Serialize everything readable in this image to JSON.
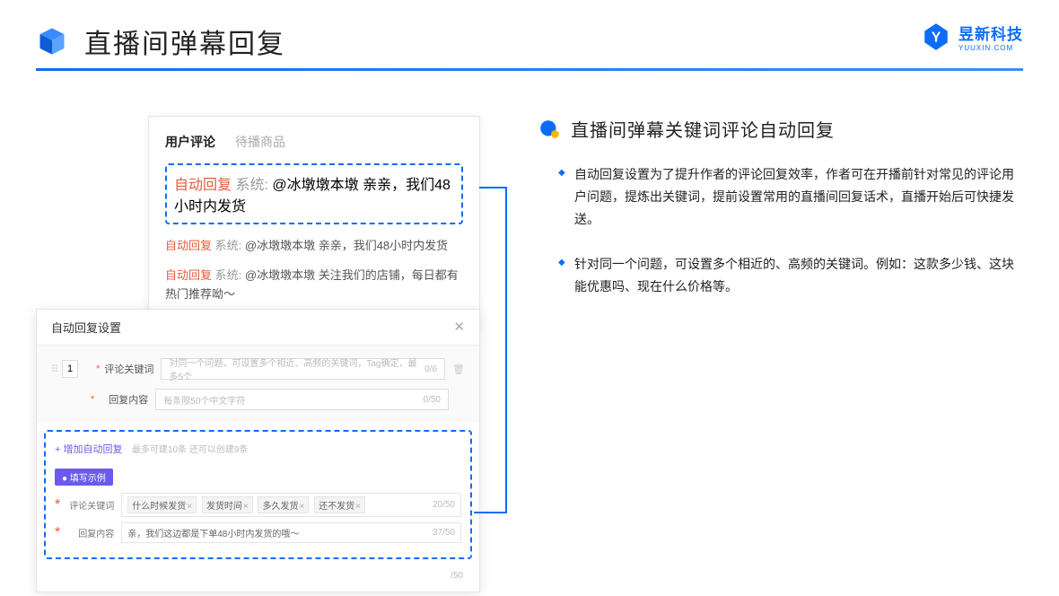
{
  "header": {
    "title": "直播间弹幕回复"
  },
  "logo": {
    "name": "昱新科技",
    "sub": "YUUXIN.COM"
  },
  "commentPanel": {
    "tabs": {
      "active": "用户评论",
      "inactive": "待播商品"
    },
    "highlighted": {
      "tag": "自动回复",
      "sys": "系统:",
      "text": "@冰墩墩本墩 亲亲，我们48小时内发货"
    },
    "rows": [
      {
        "tag": "自动回复",
        "sys": "系统:",
        "text": "@冰墩墩本墩 亲亲，我们48小时内发货"
      },
      {
        "tag": "自动回复",
        "sys": "系统:",
        "text": "@冰墩墩本墩 关注我们的店铺，每日都有热门推荐呦～"
      }
    ]
  },
  "modal": {
    "title": "自动回复设置",
    "num": "1",
    "fields": {
      "kw_label": "评论关键词",
      "kw_placeholder": "对同一个问题，可设置多个相近、高频的关键词，Tag确定，最多5个",
      "kw_count": "0/6",
      "ct_label": "回复内容",
      "ct_placeholder": "每条限50个中文字符",
      "ct_count": "0/50"
    },
    "add_link": "+ 增加自动回复",
    "add_help": "最多可建10条 还可以创建9条",
    "example_btn": "● 填写示例",
    "example": {
      "kw_label": "评论关键词",
      "tags": [
        "什么时候发货",
        "发货时间",
        "多久发货",
        "还不发货"
      ],
      "kw_count": "20/50",
      "ct_label": "回复内容",
      "ct_text": "亲，我们这边都是下单48小时内发货的哦～",
      "ct_count": "37/50"
    },
    "tail_count": "/50"
  },
  "section": {
    "title": "直播间弹幕关键词评论自动回复",
    "bullets": [
      "自动回复设置为了提升作者的评论回复效率，作者可在开播前针对常见的评论用户问题，提炼出关键词，提前设置常用的直播间回复话术，直播开始后可快捷发送。",
      "针对同一个问题，可设置多个相近的、高频的关键词。例如：这款多少钱、这块能优惠吗、现在什么价格等。"
    ]
  }
}
